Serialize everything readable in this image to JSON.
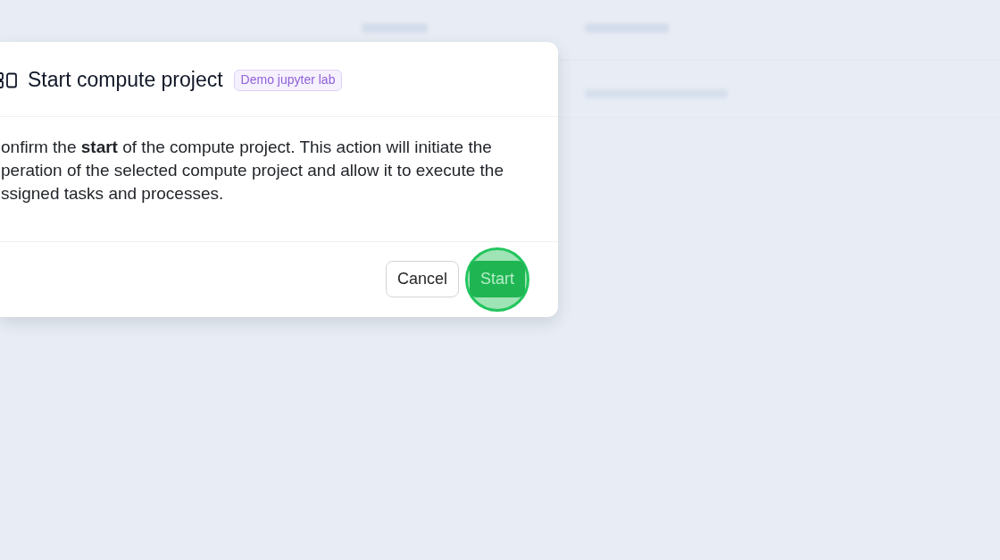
{
  "dialog": {
    "title": "Start compute project",
    "badge": "Demo jupyter lab",
    "message_lines": [
      "onfirm the **start** of the compute project. This action will initiate the",
      "peration of the selected compute project and allow it to execute the",
      "ssigned tasks and processes."
    ],
    "buttons": [
      {
        "label": "Cancel",
        "kind": "secondary",
        "highlighted": false
      },
      {
        "label": "Start",
        "kind": "primary",
        "highlighted": true
      }
    ]
  }
}
